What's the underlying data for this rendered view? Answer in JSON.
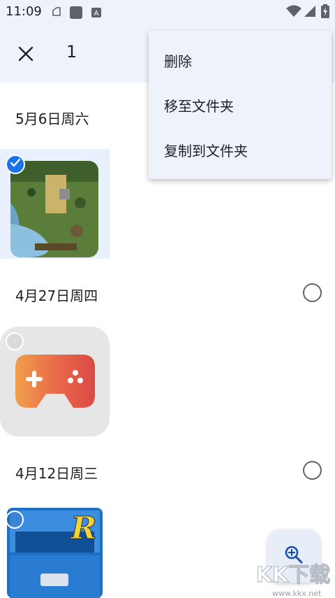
{
  "status_bar": {
    "time": "11:09",
    "icons": [
      "notification-icon",
      "app-icon",
      "keyboard-a-icon",
      "wifi-icon",
      "signal-icon",
      "battery-charging-icon"
    ]
  },
  "toolbar": {
    "close_icon": "close-icon",
    "selected_count": "1"
  },
  "overflow_menu": {
    "items": [
      {
        "label": "删除"
      },
      {
        "label": "移至文件夹"
      },
      {
        "label": "复制到文件夹"
      }
    ]
  },
  "groups": [
    {
      "date": "5月6日周六",
      "item": {
        "thumbnail": "map-game-screenshot",
        "selected": true
      }
    },
    {
      "date": "4月27日周四",
      "item": {
        "thumbnail": "game-controller-app-icon",
        "selected": false
      }
    },
    {
      "date": "4月12日周三",
      "item": {
        "thumbnail": "file-explorer-app-icon",
        "selected": false
      }
    }
  ],
  "fab": {
    "icon": "zoom-in-icon"
  },
  "watermark": {
    "text": "www.kkx.net",
    "logo_text": "KK下载"
  },
  "colors": {
    "header_bg": "#eef2fa",
    "accent_blue": "#1a73e8",
    "selected_tile_bg": "#e8f0fe"
  }
}
